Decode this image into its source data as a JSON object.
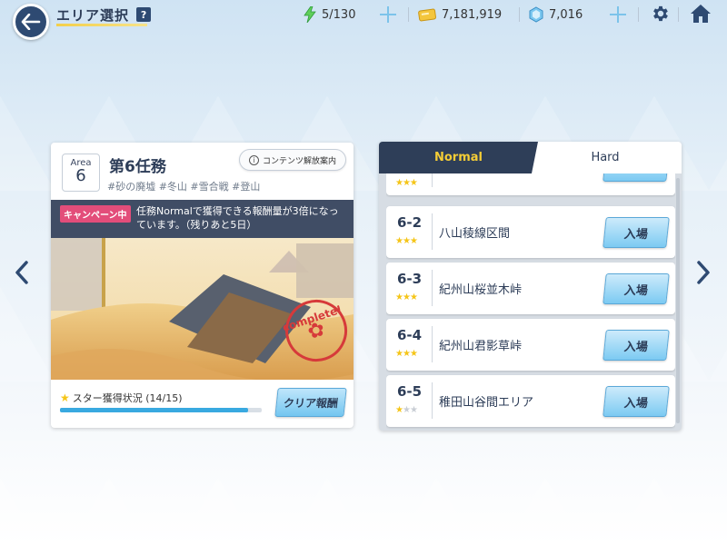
{
  "header": {
    "title": "エリア選択",
    "help": "?",
    "stamina": "5/130",
    "coins": "7,181,919",
    "gems": "7,016"
  },
  "area": {
    "label": "Area",
    "number": "6",
    "mission_title": "第6任務",
    "unlock_button": "コンテンツ解放案内",
    "tags": "#砂の廃墟 #冬山 #雪合戦 #登山",
    "campaign_badge": "キャンペーン中",
    "campaign_text": "任務Normalで獲得できる報酬量が3倍になっています。（残りあと5日）",
    "complete_stamp": "complete!",
    "star_status": "スター獲得状況 (14/15)",
    "star_progress": 0.933,
    "clear_reward_button": "クリア報酬"
  },
  "tabs": {
    "normal": "Normal",
    "hard": "Hard"
  },
  "quests": [
    {
      "id": "6-2",
      "name": "八山稜線区間",
      "stars": 3,
      "button": "入場"
    },
    {
      "id": "6-3",
      "name": "紀州山桜並木峠",
      "stars": 3,
      "button": "入場"
    },
    {
      "id": "6-4",
      "name": "紀州山君影草峠",
      "stars": 3,
      "button": "入場"
    },
    {
      "id": "6-5",
      "name": "稚田山谷間エリア",
      "stars": 1,
      "button": "入場"
    }
  ],
  "colors": {
    "accent_yellow": "#f5cd36",
    "navy": "#2e3e58",
    "campaign_pink": "#e34d7a",
    "button_blue": "#7ccaf2"
  }
}
